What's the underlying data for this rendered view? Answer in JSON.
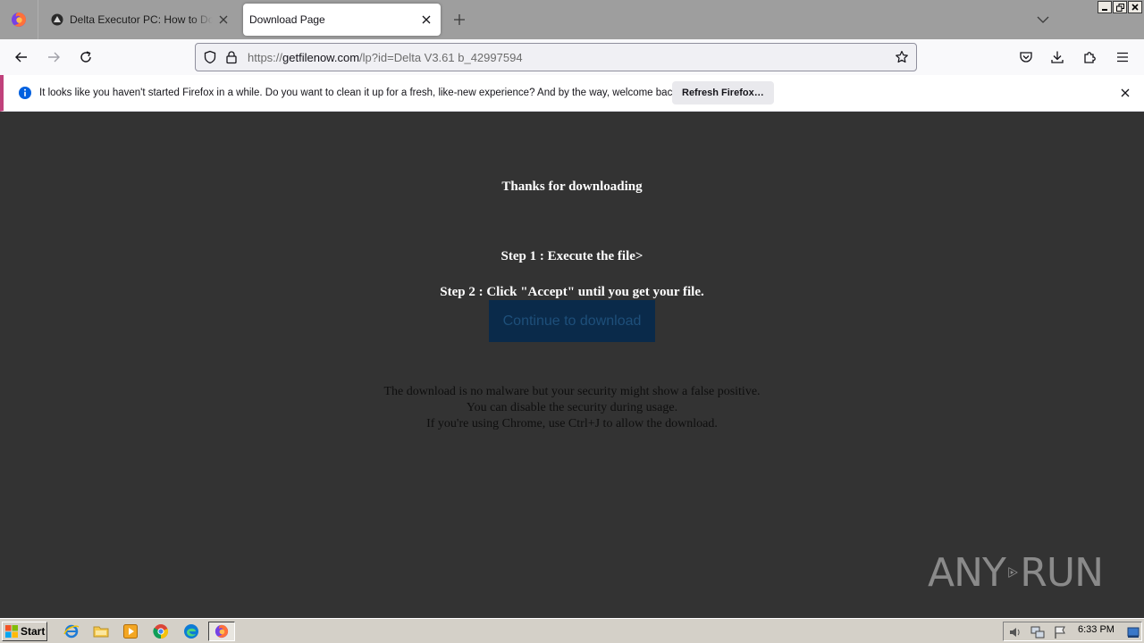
{
  "browser": {
    "tabs": [
      {
        "title": "Delta Executor PC: How to Download",
        "active": false
      },
      {
        "title": "Download Page",
        "active": true
      }
    ],
    "url": {
      "scheme": "https://",
      "domain": "getfilenow.com",
      "path": "/lp?id=Delta V3.61 b_42997594"
    }
  },
  "notification": {
    "message": "It looks like you haven't started Firefox in a while. Do you want to clean it up for a fresh, like-new experience? And by the way, welcome back!",
    "button_label": "Refresh Firefox…"
  },
  "page": {
    "heading": "Thanks for downloading",
    "step1": "Step 1 : Execute the file>",
    "step2": "Step 2 : Click \"Accept\" until you get your file.",
    "continue_button": "Continue to download",
    "disclaimer": [
      "The download is no malware but your security might show a false positive.",
      "You can disable the security during usage.",
      "If you're using Chrome, use Ctrl+J to allow the download."
    ]
  },
  "watermark": {
    "left": "ANY",
    "right": "RUN"
  },
  "taskbar": {
    "start_label": "Start",
    "clock": "6:33 PM"
  },
  "colors": {
    "page_background": "#333333",
    "button_background": "#0a2a4a",
    "notification_accent": "#c0417b",
    "info_blue": "#0060df"
  }
}
